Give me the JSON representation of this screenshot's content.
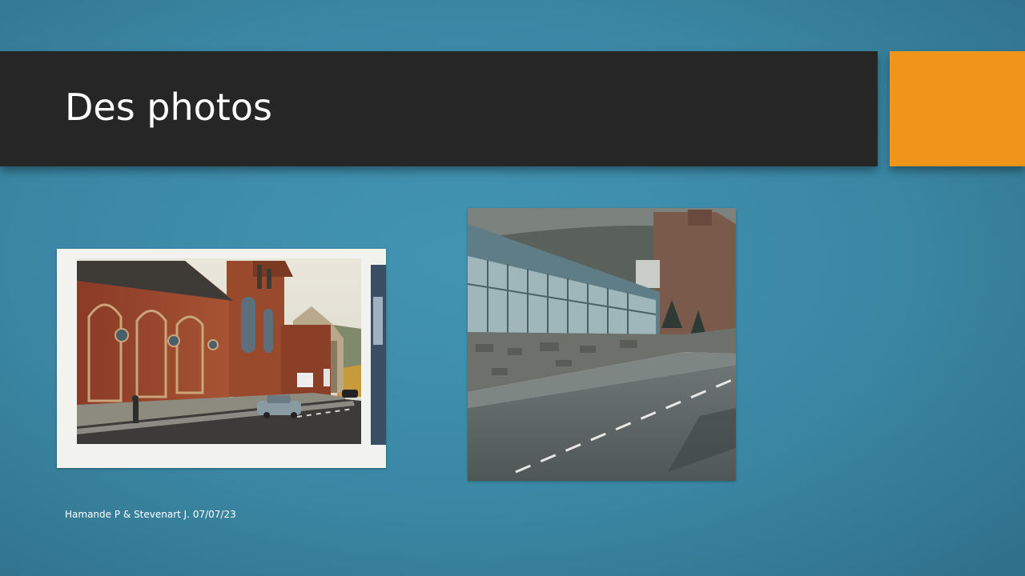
{
  "slide": {
    "title": "Des photos",
    "footer": "Hamande P & Stevenart J. 07/07/23",
    "accent_color": "#f0951a",
    "title_bar_color": "#262626"
  }
}
